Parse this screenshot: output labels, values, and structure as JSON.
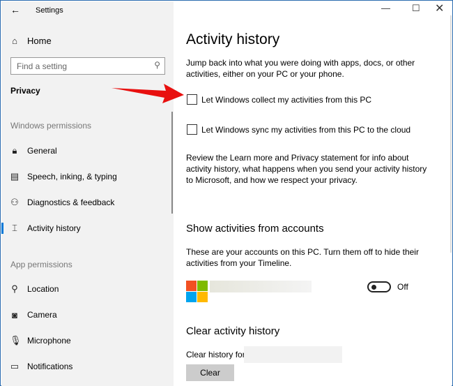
{
  "window": {
    "title": "Settings"
  },
  "sidebar": {
    "home": "Home",
    "search_placeholder": "Find a setting",
    "category": "Privacy",
    "windows_permissions": "Windows permissions",
    "items": [
      {
        "label": "General",
        "icon": "lock-icon"
      },
      {
        "label": "Speech, inking, & typing",
        "icon": "clipboard-icon"
      },
      {
        "label": "Diagnostics & feedback",
        "icon": "feedback-icon"
      },
      {
        "label": "Activity history",
        "icon": "timeline-icon"
      }
    ],
    "app_permissions": "App permissions",
    "app_items": [
      {
        "label": "Location",
        "icon": "location-icon"
      },
      {
        "label": "Camera",
        "icon": "camera-icon"
      },
      {
        "label": "Microphone",
        "icon": "microphone-icon"
      },
      {
        "label": "Notifications",
        "icon": "notifications-icon"
      }
    ]
  },
  "main": {
    "title": "Activity history",
    "intro": "Jump back into what you were doing with apps, docs, or other activities, either on your PC or your phone.",
    "checkbox1": "Let Windows collect my activities from this PC",
    "checkbox2": "Let Windows sync my activities from this PC to the cloud",
    "review": "Review the Learn more and Privacy statement for info about activity history, what happens when you send your activity history to Microsoft, and how we respect your privacy.",
    "accounts_title": "Show activities from accounts",
    "accounts_desc": "These are your accounts on this PC. Turn them off to hide their activities from your Timeline.",
    "toggle_state": "Off",
    "clear_title": "Clear activity history",
    "clear_for": "Clear history for",
    "clear_button": "Clear"
  },
  "colors": {
    "accent": "#0078d7",
    "arrow": "#e8100f"
  }
}
